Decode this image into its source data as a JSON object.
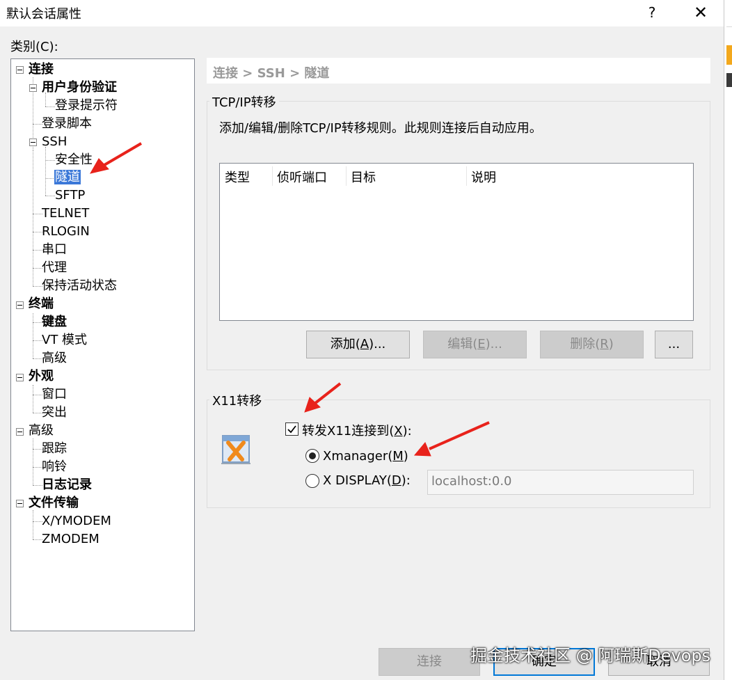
{
  "window": {
    "title": "默认会话属性",
    "help": "?",
    "close": "✕"
  },
  "category_label": "类别(C):",
  "tree": {
    "connection": "连接",
    "auth": "用户身份验证",
    "login_prompt": "登录提示符",
    "login_script": "登录脚本",
    "ssh": "SSH",
    "security": "安全性",
    "tunnel": "隧道",
    "sftp": "SFTP",
    "telnet": "TELNET",
    "rlogin": "RLOGIN",
    "serial": "串口",
    "proxy": "代理",
    "keepalive": "保持活动状态",
    "terminal": "终端",
    "keyboard": "键盘",
    "vt_mode": "VT 模式",
    "advanced_terminal": "高级",
    "appearance": "外观",
    "window": "窗口",
    "highlight": "突出",
    "advanced": "高级",
    "trace": "跟踪",
    "bell": "响铃",
    "logging": "日志记录",
    "file_transfer": "文件传输",
    "xymodem": "X/YMODEM",
    "zmodem": "ZMODEM"
  },
  "breadcrumb": "连接 > SSH > 隧道",
  "tcp": {
    "group_title": "TCP/IP转移",
    "description": "添加/编辑/删除TCP/IP转移规则。此规则连接后自动应用。",
    "columns": [
      "类型",
      "侦听端口",
      "目标",
      "说明"
    ],
    "add_prefix": "添加(",
    "add_key": "A",
    "add_suffix": ")...",
    "edit_prefix": "编辑(",
    "edit_key": "E",
    "edit_suffix": ")...",
    "delete_prefix": "删除(",
    "delete_key": "R",
    "delete_suffix": ")",
    "more": "..."
  },
  "x11": {
    "group_title": "X11转移",
    "forward_prefix": "转发X11连接到(",
    "forward_key": "X",
    "forward_suffix": "):",
    "forward_checked": true,
    "xmanager_prefix": "Xmanager(",
    "xmanager_key": "M",
    "xmanager_suffix": ")",
    "xdisplay_prefix": "X DISPLAY(",
    "xdisplay_key": "D",
    "xdisplay_suffix": "):",
    "selected": "Xmanager",
    "display_value": "localhost:0.0"
  },
  "footer": {
    "connect": "连接",
    "ok": "确定",
    "cancel": "取消"
  },
  "watermark": "掘金技术社区 @ 阿瑞斯Devops",
  "colors": {
    "selection": "#3b78d8",
    "accent": "#0078d7",
    "arrow": "#e8221b"
  }
}
